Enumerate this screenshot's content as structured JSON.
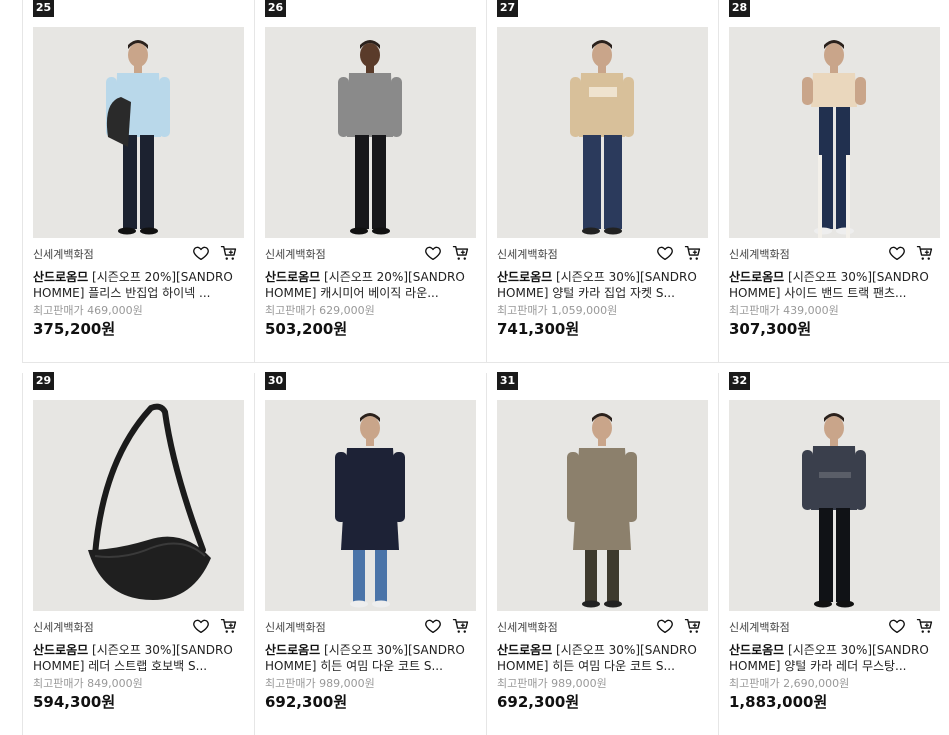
{
  "products": [
    {
      "rank": "25",
      "store": "신세계백화점",
      "brand": "산드로옴므",
      "title": " [시즌오프 20%][SANDRO HOMME] 플리스 반집업 하이넥 ...",
      "orig_price": "최고판매가 469,000원",
      "price": "375,200원",
      "image": "model-light-blue-sweater-with-bag"
    },
    {
      "rank": "26",
      "store": "신세계백화점",
      "brand": "산드로옴므",
      "title": " [시즌오프 20%][SANDRO HOMME] 캐시미어 베이직 라운...",
      "orig_price": "최고판매가 629,000원",
      "price": "503,200원",
      "image": "model-grey-sweater"
    },
    {
      "rank": "27",
      "store": "신세계백화점",
      "brand": "산드로옴므",
      "title": " [시즌오프 30%][SANDRO HOMME] 양털 카라 집업 자켓 S...",
      "orig_price": "최고판매가 1,059,000원",
      "price": "741,300원",
      "image": "model-beige-shearling-jacket"
    },
    {
      "rank": "28",
      "store": "신세계백화점",
      "brand": "산드로옴므",
      "title": " [시즌오프 30%][SANDRO HOMME] 사이드 밴드 트랙 팬츠...",
      "orig_price": "최고판매가 439,000원",
      "price": "307,300원",
      "image": "model-track-pants"
    },
    {
      "rank": "29",
      "store": "신세계백화점",
      "brand": "산드로옴므",
      "title": " [시즌오프 30%][SANDRO HOMME] 레더 스트랩 호보백 S...",
      "orig_price": "최고판매가 849,000원",
      "price": "594,300원",
      "image": "black-leather-hobo-bag"
    },
    {
      "rank": "30",
      "store": "신세계백화점",
      "brand": "산드로옴므",
      "title": " [시즌오프 30%][SANDRO HOMME] 히든 여밈 다운 코트 S...",
      "orig_price": "최고판매가 989,000원",
      "price": "692,300원",
      "image": "model-navy-coat"
    },
    {
      "rank": "31",
      "store": "신세계백화점",
      "brand": "산드로옴므",
      "title": " [시즌오프 30%][SANDRO HOMME] 히든 여밈 다운 코트 S...",
      "orig_price": "최고판매가 989,000원",
      "price": "692,300원",
      "image": "model-taupe-coat"
    },
    {
      "rank": "32",
      "store": "신세계백화점",
      "brand": "산드로옴므",
      "title": " [시즌오프 30%][SANDRO HOMME] 양털 카라 레더 무스탕...",
      "orig_price": "최고판매가 2,690,000원",
      "price": "1,883,000원",
      "image": "model-denim-jacket"
    }
  ],
  "icons": {
    "wishlist": "heart-icon",
    "cart": "cart-icon"
  },
  "colors": {
    "rank_badge": "#1a1a1a",
    "photo_bg": "#e7e6e3",
    "price": "#111111",
    "original_price": "#999999"
  }
}
